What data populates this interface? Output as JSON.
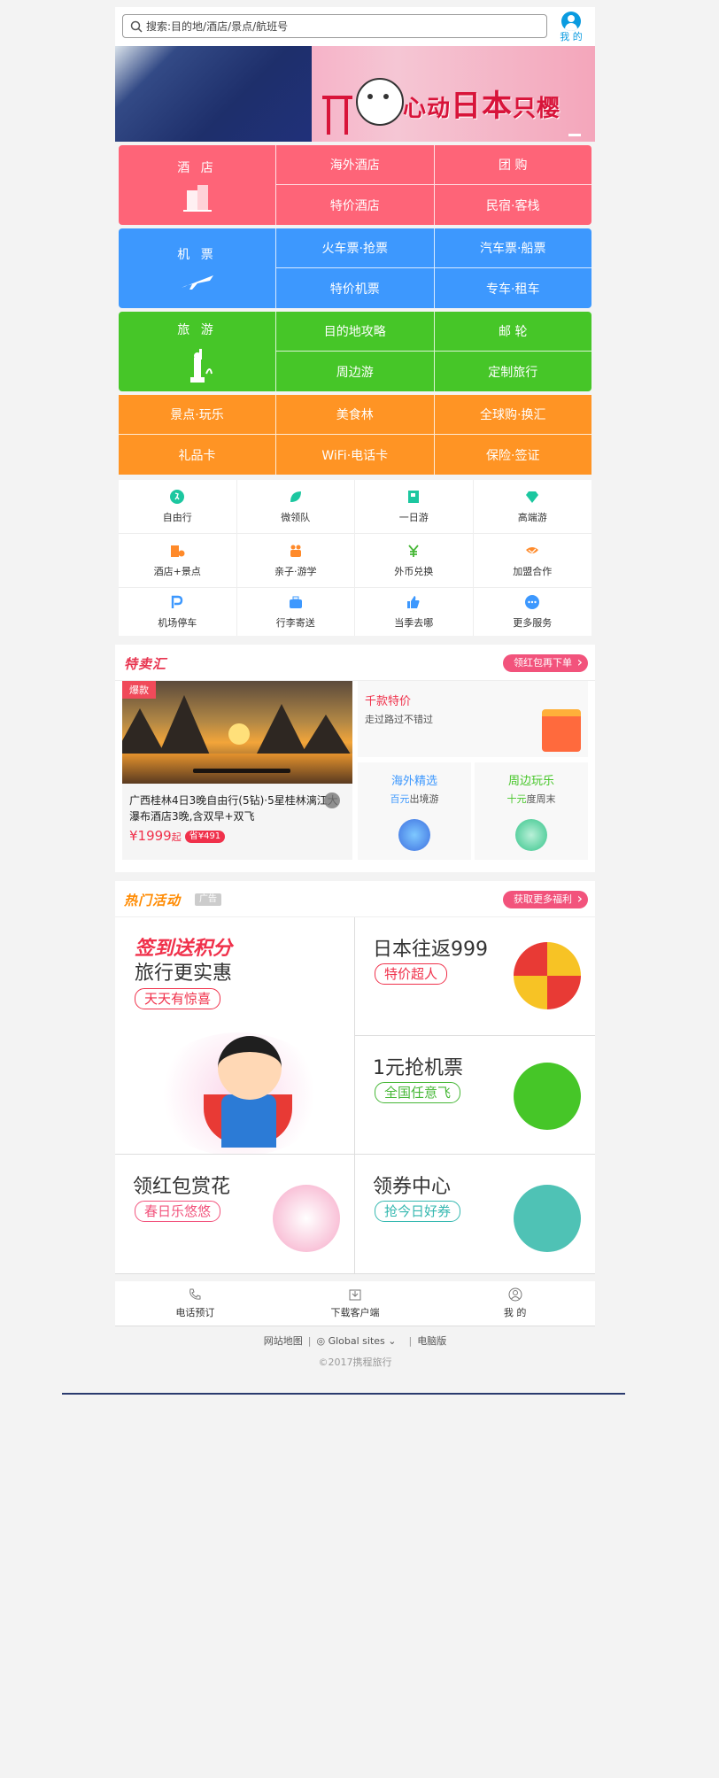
{
  "header": {
    "search_placeholder": "搜索:目的地/酒店/景点/航班号",
    "user_label": "我 的"
  },
  "banner": {
    "title_part1": "心动",
    "title_part2": "日本",
    "title_part3": "只樱"
  },
  "grid": {
    "hotel": {
      "label": "酒 店",
      "subs": [
        "海外酒店",
        "团 购",
        "特价酒店",
        "民宿·客栈"
      ]
    },
    "flight": {
      "label": "机 票",
      "subs": [
        "火车票·抢票",
        "汽车票·船票",
        "特价机票",
        "专车·租车"
      ]
    },
    "travel": {
      "label": "旅 游",
      "subs": [
        "目的地攻略",
        "邮 轮",
        "周边游",
        "定制旅行"
      ]
    },
    "orange": [
      "景点·玩乐",
      "美食林",
      "全球购·换汇",
      "礼品卡",
      "WiFi·电话卡",
      "保险·签证"
    ]
  },
  "icons": [
    {
      "label": "自由行",
      "icon": "walker-icon",
      "color": "#1cc7a0"
    },
    {
      "label": "微领队",
      "icon": "leaf-icon",
      "color": "#1cc7a0"
    },
    {
      "label": "一日游",
      "icon": "flag-icon",
      "color": "#1cc7a0"
    },
    {
      "label": "高端游",
      "icon": "diamond-icon",
      "color": "#1cc7a0"
    },
    {
      "label": "酒店+景点",
      "icon": "hotel-scenic-icon",
      "color": "#ff8a2a"
    },
    {
      "label": "亲子·游学",
      "icon": "family-icon",
      "color": "#ff8a2a"
    },
    {
      "label": "外币兑换",
      "icon": "currency-icon",
      "color": "#46b736"
    },
    {
      "label": "加盟合作",
      "icon": "handshake-icon",
      "color": "#ff8a2a"
    },
    {
      "label": "机场停车",
      "icon": "parking-icon",
      "color": "#3d98fe"
    },
    {
      "label": "行李寄送",
      "icon": "luggage-icon",
      "color": "#3d98fe"
    },
    {
      "label": "当季去哪",
      "icon": "thumb-icon",
      "color": "#3d98fe"
    },
    {
      "label": "更多服务",
      "icon": "more-icon",
      "color": "#3d98fe"
    }
  ],
  "special": {
    "title": "特卖汇",
    "button": "领红包再下单",
    "hot_tag": "爆款",
    "deal_title": "广西桂林4日3晚自由行(5钻)·5星桂林漓江大瀑布酒店3晚,含双早+双飞",
    "price": "¥1999",
    "price_suffix": "起",
    "save": "省¥491",
    "side_title": "千款特价",
    "side_desc": "走过路过不错过",
    "overseas_title": "海外精选",
    "overseas_hl": "百元",
    "overseas_rest": "出境游",
    "nearby_title": "周边玩乐",
    "nearby_hl": "十元",
    "nearby_rest": "度周末"
  },
  "activities": {
    "title": "热门活动",
    "ad": "广告",
    "button": "获取更多福利",
    "signin_hl": "签到送积分",
    "signin_title": "旅行更实惠",
    "signin_tag": "天天有惊喜",
    "japan_title": "日本往返999",
    "japan_tag": "特价超人",
    "flight_title": "1元抢机票",
    "flight_tag": "全国任意飞",
    "redpack_title": "领红包赏花",
    "redpack_tag": "春日乐悠悠",
    "coupon_title": "领券中心",
    "coupon_tag": "抢今日好券"
  },
  "bottom_nav": {
    "phone": "电话预订",
    "download": "下载客户端",
    "mine": "我 的"
  },
  "footer": {
    "sitemap": "网站地图",
    "global": "Global sites",
    "pc": "电脑版",
    "copyright": "©2017携程旅行"
  }
}
